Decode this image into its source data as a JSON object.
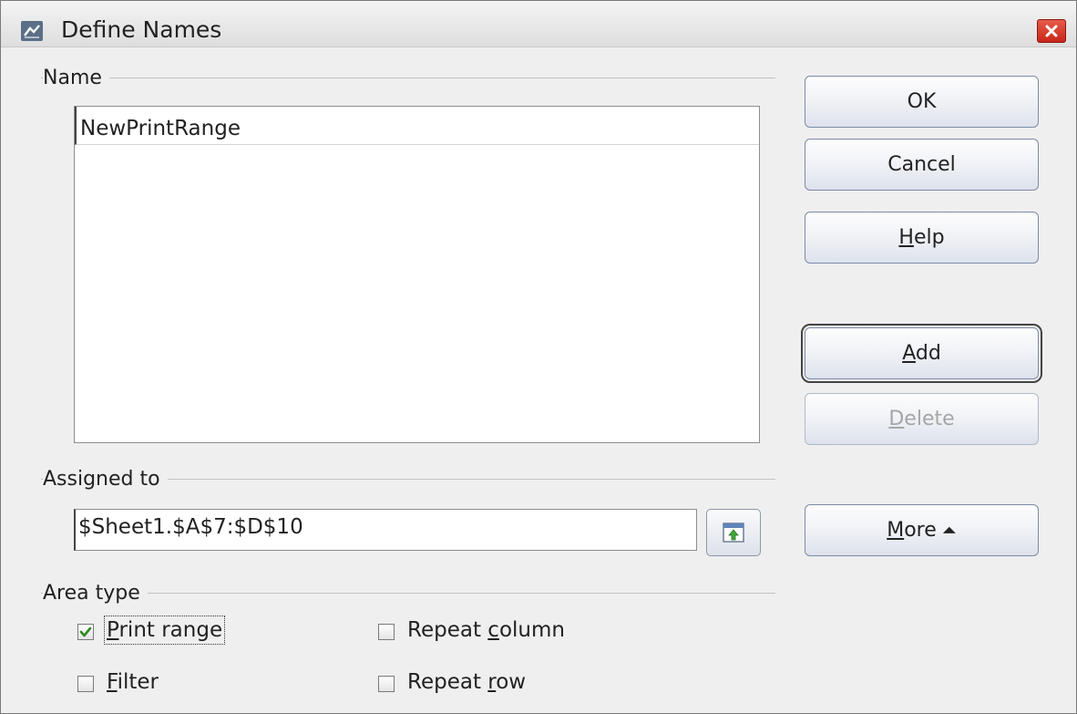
{
  "window": {
    "title": "Define Names",
    "icon": "calc-app-icon",
    "close_icon": "close-icon"
  },
  "name_section": {
    "label": "Name",
    "input_value": "NewPrintRange",
    "list_items": []
  },
  "assigned_section": {
    "label": "Assigned to",
    "value": "$Sheet1.$A$7:$D$10",
    "shrink_icon": "shrink-dialog-icon"
  },
  "area_type": {
    "label": "Area type",
    "options": [
      {
        "label_prefix": "",
        "mnemonic": "P",
        "label_rest": "rint range",
        "checked": true
      },
      {
        "label_prefix": "Repeat ",
        "mnemonic": "c",
        "label_rest": "olumn",
        "checked": false
      },
      {
        "label_prefix": "",
        "mnemonic": "F",
        "label_rest": "ilter",
        "checked": false
      },
      {
        "label_prefix": "Repeat ",
        "mnemonic": "r",
        "label_rest": "ow",
        "checked": false
      }
    ]
  },
  "buttons": {
    "ok": "OK",
    "cancel": "Cancel",
    "help_mnemonic": "H",
    "help_rest": "elp",
    "add_mnemonic": "A",
    "add_rest": "dd",
    "delete_mnemonic": "D",
    "delete_rest": "elete",
    "more_mnemonic": "M",
    "more_rest": "ore",
    "more_icon": "double-chevron-up-icon"
  },
  "colors": {
    "close_button": "#d23a2b",
    "dialog_background": "#efefef",
    "checkmark": "#2e8b1e"
  }
}
